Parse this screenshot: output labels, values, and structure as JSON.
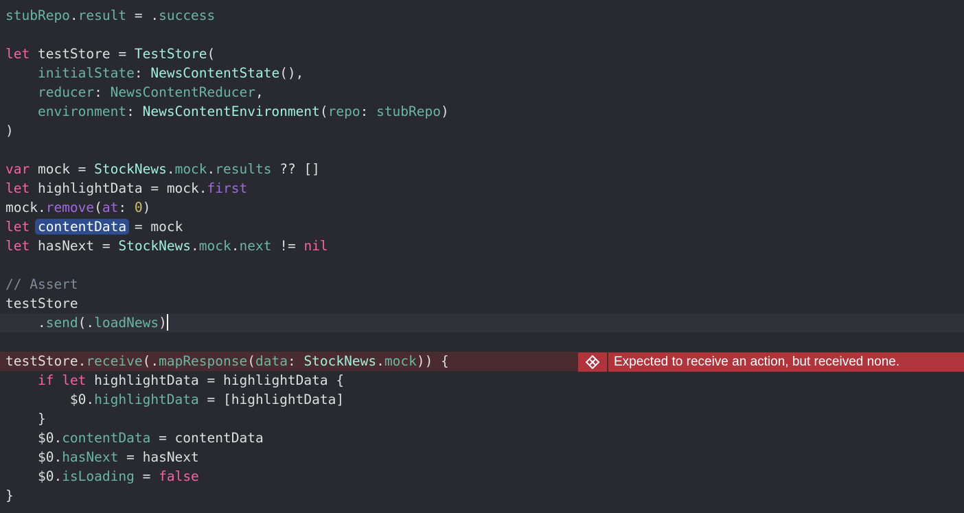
{
  "colors": {
    "background": "#292a30",
    "current_line": "#2f3239",
    "error_line": "#4a2b30",
    "error_badge": "#b1343b",
    "plain": "#dfdfe0",
    "keyword": "#fc5fa3",
    "type": "#9ef1dd",
    "property": "#67b7a4",
    "method": "#a167e6",
    "number": "#d0bf69",
    "comment": "#7f8c98",
    "selection": "#2e4d8f"
  },
  "error": {
    "icon": "error-x-icon",
    "message": "Expected to receive an action, but received none."
  },
  "code_lines": [
    [
      [
        "stubRepo",
        "property"
      ],
      [
        ".",
        "plain"
      ],
      [
        "result",
        "property"
      ],
      [
        " = .",
        "plain"
      ],
      [
        "success",
        "property"
      ]
    ],
    [],
    [
      [
        "let",
        "keyword"
      ],
      [
        " testStore = ",
        "plain"
      ],
      [
        "TestStore",
        "type"
      ],
      [
        "(",
        "plain"
      ]
    ],
    [
      [
        "    ",
        "plain"
      ],
      [
        "initialState",
        "property"
      ],
      [
        ": ",
        "plain"
      ],
      [
        "NewsContentState",
        "type"
      ],
      [
        "(),",
        "plain"
      ]
    ],
    [
      [
        "    ",
        "plain"
      ],
      [
        "reducer",
        "property"
      ],
      [
        ": ",
        "plain"
      ],
      [
        "NewsContentReducer",
        "property"
      ],
      [
        ",",
        "plain"
      ]
    ],
    [
      [
        "    ",
        "plain"
      ],
      [
        "environment",
        "property"
      ],
      [
        ": ",
        "plain"
      ],
      [
        "NewsContentEnvironment",
        "type"
      ],
      [
        "(",
        "plain"
      ],
      [
        "repo",
        "property"
      ],
      [
        ": ",
        "plain"
      ],
      [
        "stubRepo",
        "property"
      ],
      [
        ")",
        "plain"
      ]
    ],
    [
      [
        ")",
        "plain"
      ]
    ],
    [],
    [
      [
        "var",
        "keyword"
      ],
      [
        " mock = ",
        "plain"
      ],
      [
        "StockNews",
        "type"
      ],
      [
        ".",
        "plain"
      ],
      [
        "mock",
        "property"
      ],
      [
        ".",
        "plain"
      ],
      [
        "results",
        "property"
      ],
      [
        " ?? []",
        "plain"
      ]
    ],
    [
      [
        "let",
        "keyword"
      ],
      [
        " highlightData = mock.",
        "plain"
      ],
      [
        "first",
        "method"
      ]
    ],
    [
      [
        "mock.",
        "plain"
      ],
      [
        "remove",
        "method"
      ],
      [
        "(",
        "plain"
      ],
      [
        "at",
        "method"
      ],
      [
        ": ",
        "plain"
      ],
      [
        "0",
        "number"
      ],
      [
        ")",
        "plain"
      ]
    ],
    [
      [
        "let",
        "keyword"
      ],
      [
        " ",
        "plain"
      ],
      [
        "contentData",
        "selected"
      ],
      [
        " = mock",
        "plain"
      ]
    ],
    [
      [
        "let",
        "keyword"
      ],
      [
        " hasNext = ",
        "plain"
      ],
      [
        "StockNews",
        "type"
      ],
      [
        ".",
        "plain"
      ],
      [
        "mock",
        "property"
      ],
      [
        ".",
        "plain"
      ],
      [
        "next",
        "property"
      ],
      [
        " != ",
        "plain"
      ],
      [
        "nil",
        "keyword"
      ]
    ],
    [],
    [
      [
        "// Assert",
        "comment"
      ]
    ],
    [
      [
        "testStore",
        "plain"
      ]
    ],
    [
      [
        "    .",
        "plain"
      ],
      [
        "send",
        "property"
      ],
      [
        "(.",
        "plain"
      ],
      [
        "loadNews",
        "property"
      ],
      [
        ")",
        "plain"
      ]
    ],
    [],
    [
      [
        "testStore",
        "plain"
      ],
      [
        ".",
        "plain"
      ],
      [
        "receive",
        "property"
      ],
      [
        "(.",
        "plain"
      ],
      [
        "mapResponse",
        "property"
      ],
      [
        "(",
        "plain"
      ],
      [
        "data",
        "property"
      ],
      [
        ": ",
        "plain"
      ],
      [
        "StockNews",
        "type"
      ],
      [
        ".",
        "plain"
      ],
      [
        "mock",
        "property"
      ],
      [
        ")) {",
        "plain"
      ]
    ],
    [
      [
        "    ",
        "plain"
      ],
      [
        "if",
        "keyword"
      ],
      [
        " ",
        "plain"
      ],
      [
        "let",
        "keyword"
      ],
      [
        " highlightData = highlightData {",
        "plain"
      ]
    ],
    [
      [
        "        $0.",
        "plain"
      ],
      [
        "highlightData",
        "property"
      ],
      [
        " = [highlightData]",
        "plain"
      ]
    ],
    [
      [
        "    }",
        "plain"
      ]
    ],
    [
      [
        "    $0.",
        "plain"
      ],
      [
        "contentData",
        "property"
      ],
      [
        " = contentData",
        "plain"
      ]
    ],
    [
      [
        "    $0.",
        "plain"
      ],
      [
        "hasNext",
        "property"
      ],
      [
        " = hasNext",
        "plain"
      ]
    ],
    [
      [
        "    $0.",
        "plain"
      ],
      [
        "isLoading",
        "property"
      ],
      [
        " = ",
        "plain"
      ],
      [
        "false",
        "keyword"
      ]
    ],
    [
      [
        "}",
        "plain"
      ]
    ]
  ]
}
